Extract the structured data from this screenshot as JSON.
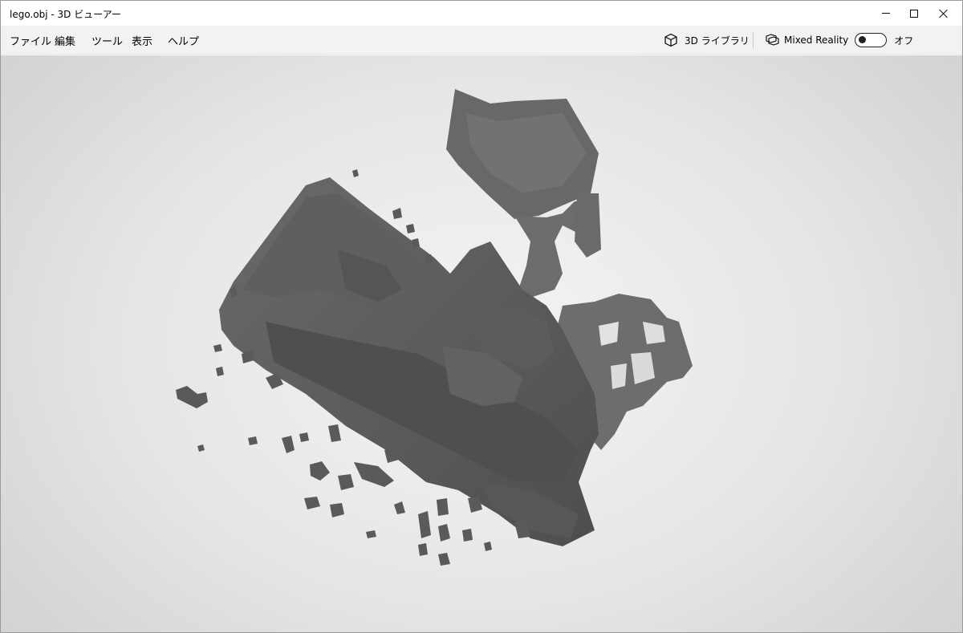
{
  "window": {
    "title": "lego.obj - 3D ビューアー"
  },
  "menu": {
    "file": "ファイル",
    "edit": "編集",
    "tools": "ツール",
    "view": "表示",
    "help": "ヘルプ"
  },
  "toolbar": {
    "library_label": "3D ライブラリ",
    "library_icon": "cube-outline-icon",
    "mixed_reality_label": "Mixed Reality",
    "mixed_reality_icon": "mixed-reality-icon",
    "mixed_reality_state": "オフ",
    "mixed_reality_on": false
  },
  "viewport": {
    "model_color": "#5a5a5a"
  }
}
